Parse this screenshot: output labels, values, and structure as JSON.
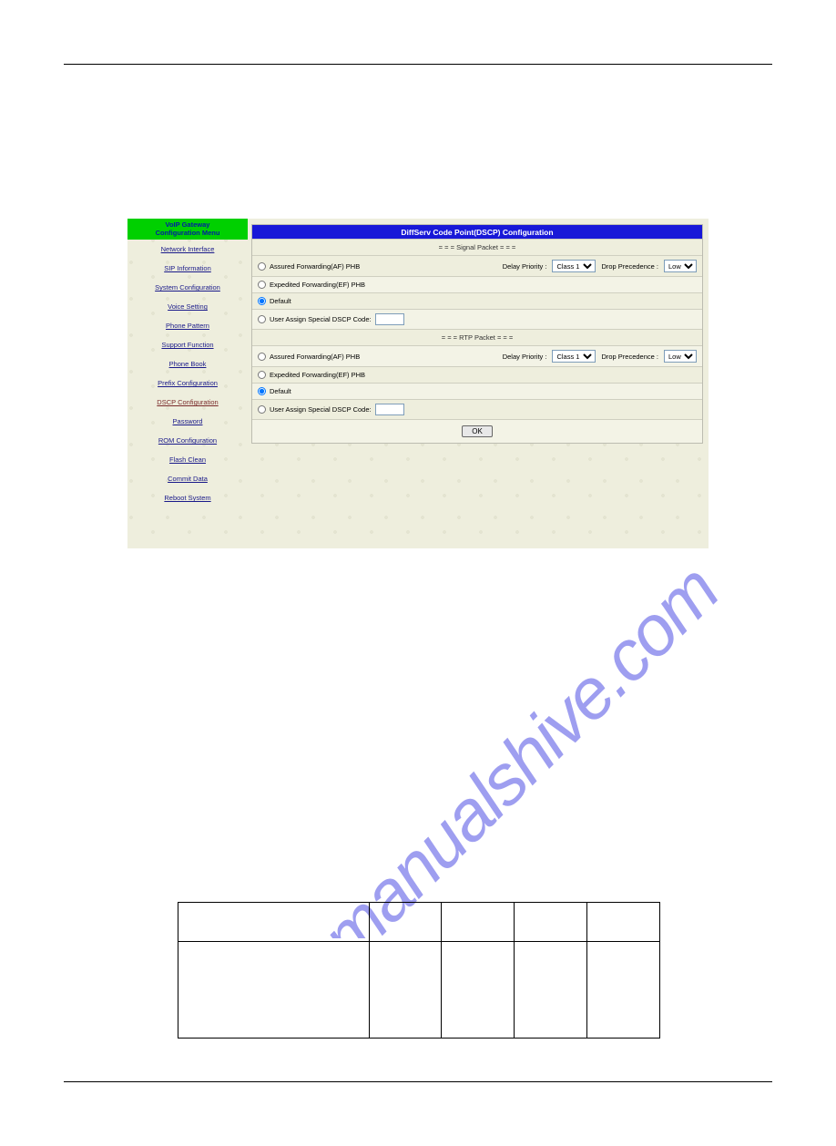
{
  "watermark": "manualshive.com",
  "sidebar": {
    "header_line1": "VoIP Gateway",
    "header_line2": "Configuration Menu",
    "items": [
      {
        "label": "Network Interface"
      },
      {
        "label": "SIP Information"
      },
      {
        "label": "System Configuration"
      },
      {
        "label": "Voice Setting"
      },
      {
        "label": "Phone Pattern"
      },
      {
        "label": "Support Function"
      },
      {
        "label": "Phone Book"
      },
      {
        "label": "Prefix Configuration"
      },
      {
        "label": "DSCP Configuration"
      },
      {
        "label": "Password"
      },
      {
        "label": "ROM Configuration"
      },
      {
        "label": "Flash Clean"
      },
      {
        "label": "Commit Data"
      },
      {
        "label": "Reboot System"
      }
    ],
    "active_index": 8
  },
  "panel": {
    "title": "DiffServ Code Point(DSCP) Configuration",
    "signal_header": "= = = Signal Packet = = =",
    "rtp_header": "= = = RTP Packet = = =",
    "opt_af": "Assured Forwarding(AF) PHB",
    "opt_ef": "Expedited Forwarding(EF) PHB",
    "opt_default": "Default",
    "opt_user": "User Assign Special DSCP Code:",
    "delay_label": "Delay Priority :",
    "drop_label": "Drop Precedence :",
    "delay_value": "Class 1",
    "drop_value": "Low",
    "ok": "OK",
    "signal_selected": "default",
    "rtp_selected": "default"
  }
}
